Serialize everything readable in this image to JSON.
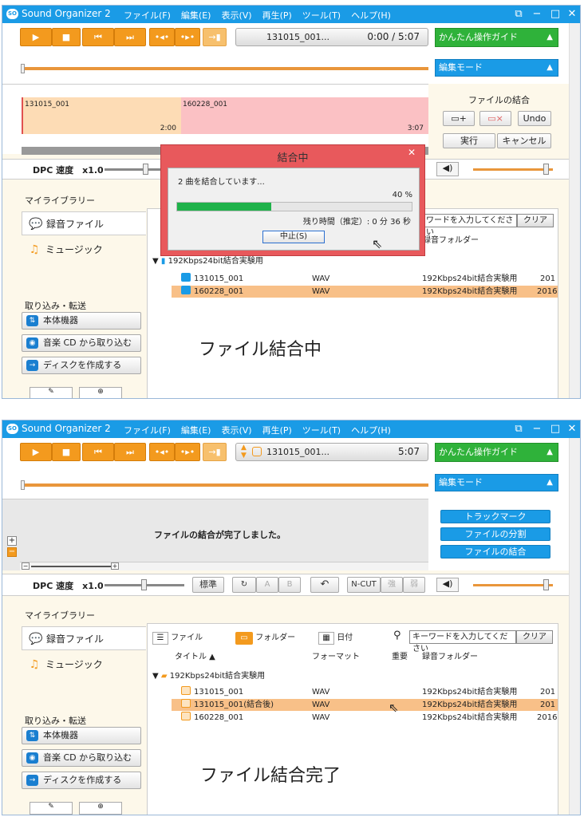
{
  "app": {
    "title": "Sound Organizer 2",
    "logo_text": "SO"
  },
  "menu": [
    "ファイル(F)",
    "編集(E)",
    "表示(V)",
    "再生(P)",
    "ツール(T)",
    "ヘルプ(H)"
  ],
  "guide_label": "かんたん操作ガイド",
  "mode_label": "編集モード",
  "top": {
    "track_name": "131015_001...",
    "track_time": "0:00 / 5:07",
    "segments": [
      {
        "name": "131015_001",
        "end": "2:00"
      },
      {
        "name": "160228_001",
        "end": "3:07"
      }
    ],
    "combine_panel": {
      "title": "ファイルの結合",
      "undo": "Undo",
      "execute": "実行",
      "cancel": "キャンセル"
    },
    "speed_label": "DPC 速度　x1.0",
    "dialog": {
      "title": "結合中",
      "message": "2 曲を結合しています...",
      "percent_text": "40 %",
      "progress": 0.4,
      "remaining": "残り時間（推定）: 0 分 36 秒",
      "abort": "中止(S)"
    },
    "search_placeholder": "ワードを入力してください",
    "clear": "クリア",
    "col_folder": "録音フォルダー",
    "folder_name": "192Kbps24bit結合実験用",
    "rows": [
      {
        "title": "131015_001",
        "format": "WAV",
        "folder": "192Kbps24bit結合実験用",
        "date": "201"
      },
      {
        "title": "160228_001",
        "format": "WAV",
        "folder": "192Kbps24bit結合実験用",
        "date": "2016"
      }
    ],
    "caption": "ファイル結合中"
  },
  "bottom": {
    "track_name": "131015_001...",
    "track_time": "5:07",
    "done_message": "ファイルの結合が完了しました。",
    "edit_buttons": [
      "トラックマーク",
      "ファイルの分割",
      "ファイルの結合"
    ],
    "speed_label": "DPC 速度　x1.0",
    "std_label": "標準",
    "ab_a": "A",
    "ab_b": "B",
    "ncut": "N-CUT",
    "strong": "強",
    "weak": "弱",
    "views": [
      "ファイル",
      "フォルダー",
      "日付"
    ],
    "search_placeholder": "キーワードを入力してください",
    "clear": "クリア",
    "columns": {
      "title": "タイトル ▲",
      "format": "フォーマット",
      "important": "重要",
      "folder": "録音フォルダー"
    },
    "folder_name": "192Kbps24bit結合実験用",
    "rows": [
      {
        "title": "131015_001",
        "format": "WAV",
        "folder": "192Kbps24bit結合実験用",
        "date": "201"
      },
      {
        "title": "131015_001(結合後)",
        "format": "WAV",
        "folder": "192Kbps24bit結合実験用",
        "date": "201"
      },
      {
        "title": "160228_001",
        "format": "WAV",
        "folder": "192Kbps24bit結合実験用",
        "date": "2016"
      }
    ],
    "caption": "ファイル結合完了"
  },
  "sidebar": {
    "library": "マイライブラリー",
    "recorded": "録音ファイル",
    "music": "ミュージック",
    "import_header": "取り込み・転送",
    "device": "本体機器",
    "cd_import": "音楽 CD から取り込む",
    "make_disc": "ディスクを作成する"
  },
  "colors": {
    "accent_orange": "#f39a1e",
    "title_blue": "#1a9be6",
    "guide_green": "#2fb23a",
    "dialog_red": "#e8595c"
  }
}
